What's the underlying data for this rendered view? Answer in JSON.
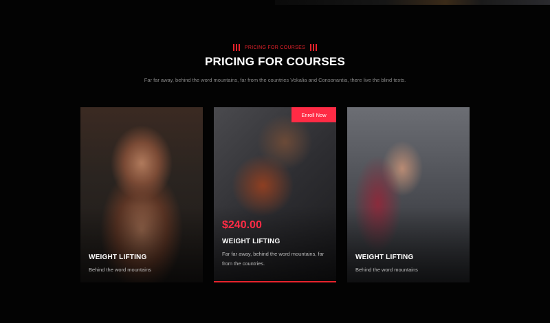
{
  "section": {
    "subheading": "Pricing for Courses",
    "heading": "PRICING FOR COURSES",
    "lead": "Far far away, behind the word mountains, far from the countries Vokalia and Consonantia, there live the blind texts."
  },
  "cards": [
    {
      "title": "WEIGHT LIFTING",
      "desc": "Behind the word mountains"
    },
    {
      "title": "WEIGHT LIFTING",
      "price": "$240.00",
      "desc": "Far far away, behind the word mountains, far from the countries.",
      "enroll_label": "Enroll Now"
    },
    {
      "title": "WEIGHT LIFTING",
      "desc": "Behind the word mountains"
    }
  ],
  "colors": {
    "accent": "#ff2b45",
    "subheading": "#e8232c",
    "background": "#030303"
  }
}
